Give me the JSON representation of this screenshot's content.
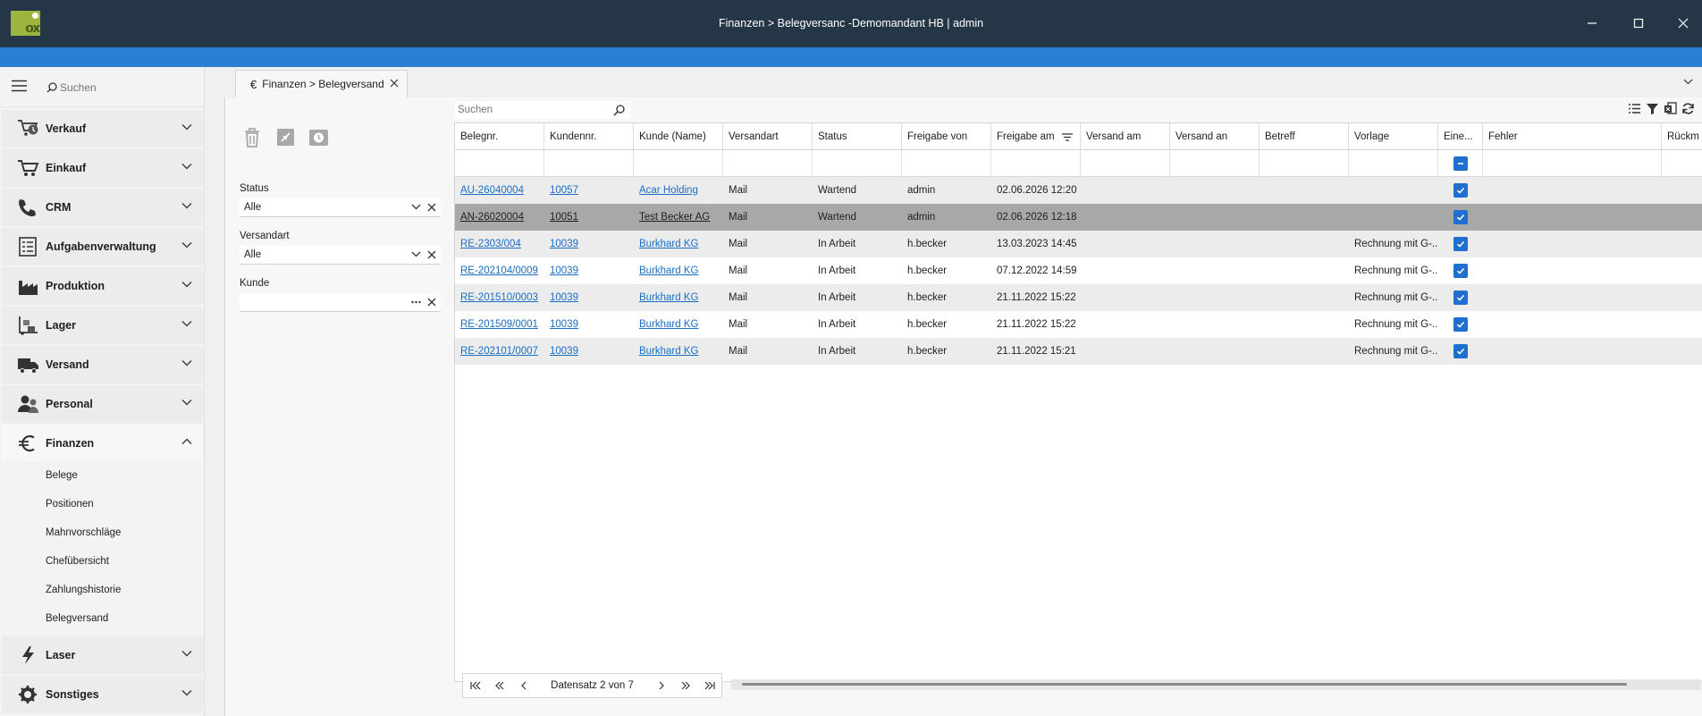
{
  "window": {
    "title": "Finanzen > Belegversanc -Demomandant HB | admin",
    "logo_text": "ox"
  },
  "sidebar": {
    "search_placeholder": "Suchen",
    "items": [
      {
        "label": "Verkauf",
        "icon": "sales-icon"
      },
      {
        "label": "Einkauf",
        "icon": "cart-icon"
      },
      {
        "label": "CRM",
        "icon": "phone-icon"
      },
      {
        "label": "Aufgabenverwaltung",
        "icon": "task-list-icon"
      },
      {
        "label": "Produktion",
        "icon": "factory-icon"
      },
      {
        "label": "Lager",
        "icon": "warehouse-icon"
      },
      {
        "label": "Versand",
        "icon": "truck-icon"
      },
      {
        "label": "Personal",
        "icon": "people-icon"
      },
      {
        "label": "Finanzen",
        "icon": "euro-icon",
        "expanded": true
      },
      {
        "label": "Laser",
        "icon": "lightning-icon"
      },
      {
        "label": "Sonstiges",
        "icon": "gear-icon"
      }
    ],
    "finanzen_sub": [
      "Belege",
      "Positionen",
      "Mahnvorschläge",
      "Chefübersicht",
      "Zahlungshistorie",
      "Belegversand"
    ]
  },
  "tab": {
    "label": "Finanzen > Belegversand",
    "icon": "euro-icon"
  },
  "filter": {
    "status_label": "Status",
    "status_value": "Alle",
    "versandart_label": "Versandart",
    "versandart_value": "Alle",
    "kunde_label": "Kunde",
    "kunde_value": ""
  },
  "grid": {
    "search_placeholder": "Suchen",
    "columns": [
      "Belegnr.",
      "Kundennr.",
      "Kunde (Name)",
      "Versandart",
      "Status",
      "Freigabe von",
      "Freigabe am",
      "Versand am",
      "Versand an",
      "Betreff",
      "Vorlage",
      "Eine...",
      "Fehler",
      "Rückm"
    ],
    "rows": [
      {
        "belegnr": "AU-26040004",
        "kundennr": "10057",
        "kunde": "Acar Holding",
        "versandart": "Mail",
        "status": "Wartend",
        "freigabe_von": "admin",
        "freigabe_am": "02.06.2026 12:20",
        "versand_am": "",
        "versand_an": "",
        "betreff": "",
        "vorlage": "",
        "einzeln": true,
        "fehler": ""
      },
      {
        "belegnr": "AN-26020004",
        "kundennr": "10051",
        "kunde": "Test Becker AG",
        "versandart": "Mail",
        "status": "Wartend",
        "freigabe_von": "admin",
        "freigabe_am": "02.06.2026 12:18",
        "versand_am": "",
        "versand_an": "",
        "betreff": "",
        "vorlage": "",
        "einzeln": true,
        "fehler": "",
        "selected": true
      },
      {
        "belegnr": "RE-2303/004",
        "kundennr": "10039",
        "kunde": "Burkhard KG",
        "versandart": "Mail",
        "status": "In Arbeit",
        "freigabe_von": "h.becker",
        "freigabe_am": "13.03.2023 14:45",
        "versand_am": "",
        "versand_an": "",
        "betreff": "",
        "vorlage": "Rechnung mit G-...",
        "einzeln": true,
        "fehler": ""
      },
      {
        "belegnr": "RE-202104/0009",
        "kundennr": "10039",
        "kunde": "Burkhard KG",
        "versandart": "Mail",
        "status": "In Arbeit",
        "freigabe_von": "h.becker",
        "freigabe_am": "07.12.2022 14:59",
        "versand_am": "",
        "versand_an": "",
        "betreff": "",
        "vorlage": "Rechnung mit G-...",
        "einzeln": true,
        "fehler": ""
      },
      {
        "belegnr": "RE-201510/0003",
        "kundennr": "10039",
        "kunde": "Burkhard KG",
        "versandart": "Mail",
        "status": "In Arbeit",
        "freigabe_von": "h.becker",
        "freigabe_am": "21.11.2022 15:22",
        "versand_am": "",
        "versand_an": "",
        "betreff": "",
        "vorlage": "Rechnung mit G-...",
        "einzeln": true,
        "fehler": ""
      },
      {
        "belegnr": "RE-201509/0001",
        "kundennr": "10039",
        "kunde": "Burkhard KG",
        "versandart": "Mail",
        "status": "In Arbeit",
        "freigabe_von": "h.becker",
        "freigabe_am": "21.11.2022 15:22",
        "versand_am": "",
        "versand_an": "",
        "betreff": "",
        "vorlage": "Rechnung mit G-...",
        "einzeln": true,
        "fehler": ""
      },
      {
        "belegnr": "RE-202101/0007",
        "kundennr": "10039",
        "kunde": "Burkhard KG",
        "versandart": "Mail",
        "status": "In Arbeit",
        "freigabe_von": "h.becker",
        "freigabe_am": "21.11.2022 15:21",
        "versand_am": "",
        "versand_an": "",
        "betreff": "",
        "vorlage": "Rechnung mit G-...",
        "einzeln": true,
        "fehler": ""
      }
    ]
  },
  "pager": {
    "text": "Datensatz 2 von 7"
  },
  "colors": {
    "titlebar": "#253746",
    "accent_bar": "#2b7fd3",
    "checkbox": "#1e6fcf",
    "link": "#1a6fc4",
    "selected_row": "#a8a8a8",
    "logo": "#9cb53f"
  }
}
